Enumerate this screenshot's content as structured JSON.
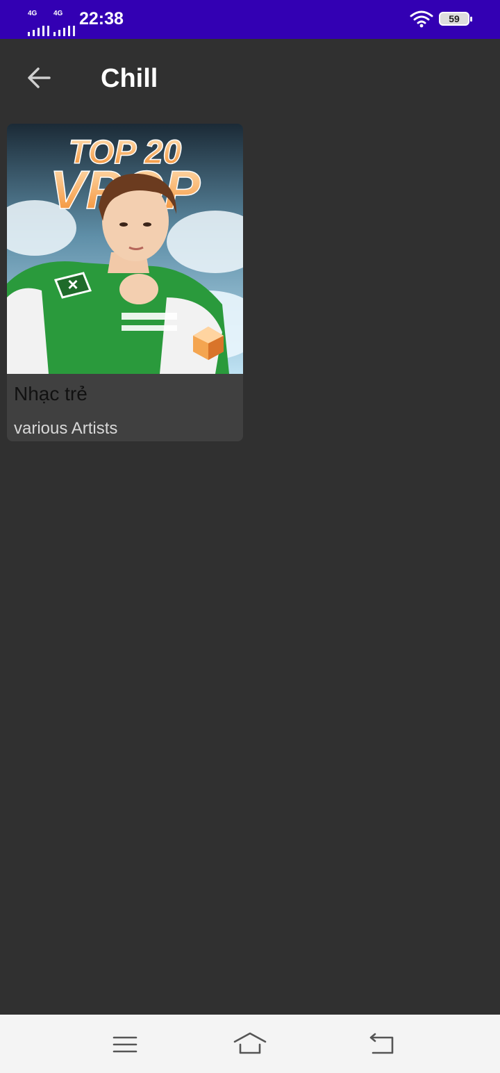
{
  "status_bar": {
    "signal1_label": "4G",
    "signal2_label": "4G",
    "time": "22:38",
    "battery_level": "59",
    "wifi_icon": "wifi-icon"
  },
  "app_bar": {
    "back_icon": "arrow-back-icon",
    "title": "Chill"
  },
  "playlist": [
    {
      "cover_lines": [
        "TOP 20",
        "VPOP"
      ],
      "title": "Nhạc trẻ",
      "subtitle": "various Artists"
    }
  ],
  "nav_bar": {
    "menu_icon": "menu-icon",
    "home_icon": "home-icon",
    "back_icon": "back-icon"
  },
  "colors": {
    "status_bar": "#3300b3",
    "background": "#303030",
    "card": "#404040",
    "nav_bar": "#f4f4f4"
  }
}
